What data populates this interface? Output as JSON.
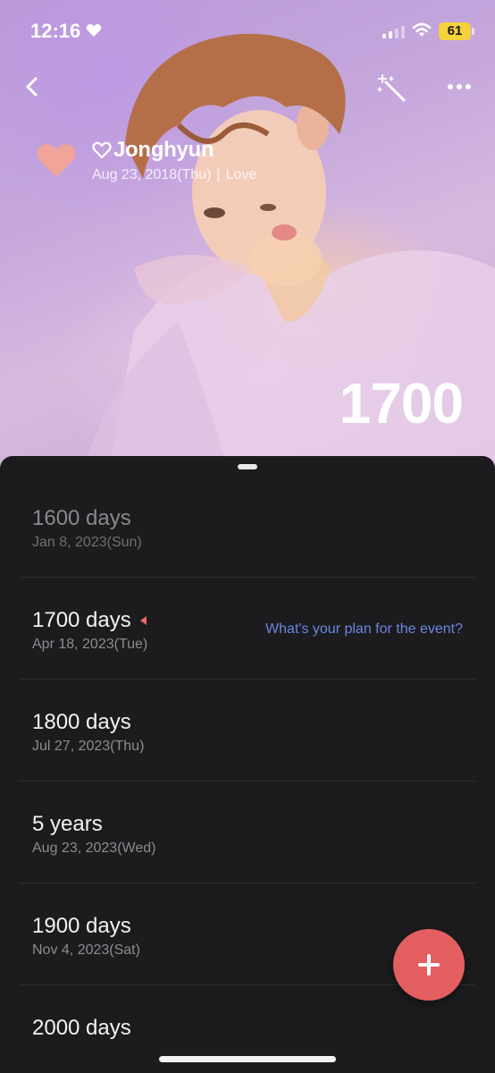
{
  "status_bar": {
    "time": "12:16",
    "battery": "61"
  },
  "event": {
    "title": "Jonghyun",
    "date": "Aug 23, 2018(Thu)",
    "category": "Love",
    "day_count": "1700"
  },
  "milestones": [
    {
      "label": "1600 days",
      "date": "Jan 8, 2023(Sun)"
    },
    {
      "label": "1700 days",
      "date": "Apr 18, 2023(Tue)",
      "plan": "What's your plan for the event?"
    },
    {
      "label": "1800 days",
      "date": "Jul 27, 2023(Thu)"
    },
    {
      "label": "5 years",
      "date": "Aug 23, 2023(Wed)"
    },
    {
      "label": "1900 days",
      "date": "Nov 4, 2023(Sat)"
    },
    {
      "label": "2000 days",
      "date": ""
    }
  ],
  "colors": {
    "accent": "#e35f5f",
    "link": "#6b86e0",
    "heart": "#f2a39a",
    "battery": "#f3d23b"
  }
}
